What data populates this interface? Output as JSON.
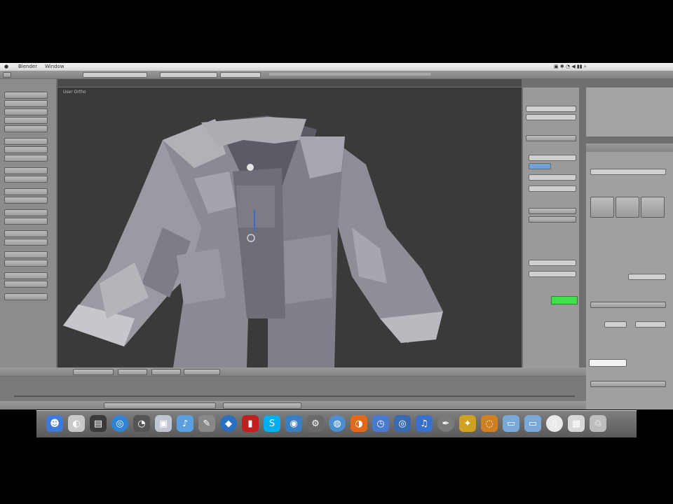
{
  "window": {
    "menubar_items": [
      "Blender",
      "Window"
    ]
  },
  "viewport": {
    "label": "User Ortho"
  },
  "dock": {
    "icons": [
      {
        "name": "finder-icon",
        "color": "#3f7ad8",
        "glyph": "☻"
      },
      {
        "name": "system-icon",
        "color": "#c9c9c9",
        "glyph": "◐"
      },
      {
        "name": "terminal-icon",
        "color": "#3a3a3a",
        "glyph": "▤"
      },
      {
        "name": "safari-icon",
        "color": "#2f84d6",
        "glyph": "◎"
      },
      {
        "name": "timemachine-icon",
        "color": "#555",
        "glyph": "◔"
      },
      {
        "name": "preview-icon",
        "color": "#c0c6d2",
        "glyph": "▣"
      },
      {
        "name": "itunes-icon",
        "color": "#5aa0e0",
        "glyph": "♪"
      },
      {
        "name": "tools-icon",
        "color": "#888",
        "glyph": "✎"
      },
      {
        "name": "app-icon",
        "color": "#2a6fc0",
        "glyph": "◆"
      },
      {
        "name": "book-icon",
        "color": "#c02020",
        "glyph": "▮"
      },
      {
        "name": "skype-icon",
        "color": "#00aff0",
        "glyph": "S"
      },
      {
        "name": "globe-icon",
        "color": "#3a7fc1",
        "glyph": "◉"
      },
      {
        "name": "utility-icon",
        "color": "#6a6a6a",
        "glyph": "⚙"
      },
      {
        "name": "earth-icon",
        "color": "#4a90d0",
        "glyph": "◍"
      },
      {
        "name": "firefox-icon",
        "color": "#e06a1a",
        "glyph": "◑"
      },
      {
        "name": "clock-icon",
        "color": "#4a7ad0",
        "glyph": "◷"
      },
      {
        "name": "media-icon",
        "color": "#3a6ab0",
        "glyph": "◎"
      },
      {
        "name": "itunes-note-icon",
        "color": "#3a70c8",
        "glyph": "♫"
      },
      {
        "name": "pen-icon",
        "color": "#7a7a7a",
        "glyph": "✒"
      },
      {
        "name": "star-icon",
        "color": "#d0a020",
        "glyph": "✦"
      },
      {
        "name": "disc-icon",
        "color": "#d08020",
        "glyph": "◌"
      },
      {
        "name": "folder-icon",
        "color": "#7aa8d8",
        "glyph": "▭"
      },
      {
        "name": "folder-icon-2",
        "color": "#7aa8d8",
        "glyph": "▭"
      },
      {
        "name": "document-icon",
        "color": "#eaeaea",
        "glyph": "▯"
      },
      {
        "name": "screenshot-icon",
        "color": "#d8d8d8",
        "glyph": "▦"
      },
      {
        "name": "trash-icon",
        "color": "#bdbdbd",
        "glyph": "♲"
      }
    ]
  },
  "colors": {
    "viewport_bg": "#3a3a3a",
    "accent_green": "#41e04a",
    "panel_gray": "#8c8c8c"
  }
}
